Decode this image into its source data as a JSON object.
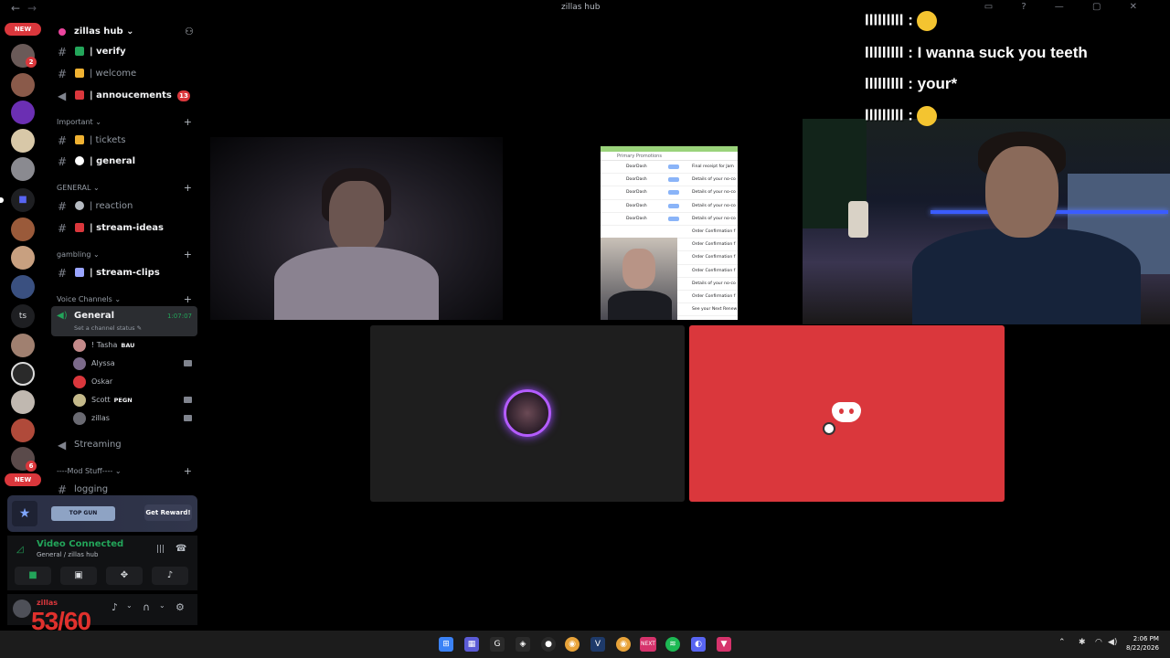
{
  "window": {
    "title": "zillas hub"
  },
  "guilds": {
    "new_label": "NEW",
    "mention_counts": [
      "2",
      "6"
    ],
    "text_guild": "ts"
  },
  "server": {
    "name": "zillas hub",
    "channels_top": [
      {
        "label": "| verify",
        "emoji_color": "#23a55a",
        "bright": true
      },
      {
        "label": "| welcome",
        "emoji_color": "#f0b232",
        "bright": false
      },
      {
        "label": "| annoucements",
        "emoji_color": "#da373c",
        "bright": true,
        "badge": "13"
      }
    ],
    "categories": {
      "important": "Important",
      "general": "GENERAL",
      "gambling": "gambling",
      "voice": "Voice Channels",
      "mod": "----Mod Stuff----"
    },
    "important_channels": [
      {
        "label": "| tickets",
        "emoji_color": "#f0b232",
        "bright": false
      },
      {
        "label": "| general",
        "emoji_color": "#ffffff",
        "bright": true
      }
    ],
    "general_channels": [
      {
        "label": "| reaction",
        "emoji_color": "#b5bac1",
        "bright": false
      },
      {
        "label": "| stream-ideas",
        "emoji_color": "#da373c",
        "bright": true
      }
    ],
    "gambling_channels": [
      {
        "label": "| stream-clips",
        "emoji_color": "#9aa5ff",
        "bright": true
      }
    ],
    "voice_channel": {
      "name": "General",
      "time": "1:07:07",
      "status": "Set a channel status"
    },
    "voice_users": [
      {
        "name": "! Tasha",
        "tag": "BAU",
        "av": "#c48a8a"
      },
      {
        "name": "Alyssa",
        "tag": "",
        "av": "#7b6a8a"
      },
      {
        "name": "Oskar",
        "tag": "",
        "av": "#da373c"
      },
      {
        "name": "Scott",
        "tag": "PEGN",
        "av": "#c4b98a"
      },
      {
        "name": "zillas",
        "tag": "",
        "av": "#6a6a72"
      }
    ],
    "streaming_channel": "Streaming",
    "mod_channel": "logging"
  },
  "promo": {
    "brand": "TOP GUN",
    "cta": "Get Reward!"
  },
  "voice_connected": {
    "status": "Video Connected",
    "location": "General / zillas hub"
  },
  "user": {
    "name": "zillas"
  },
  "overlay": {
    "fps": "53/60"
  },
  "chat": [
    {
      "user": "lllllllll",
      "text": ":",
      "emoji": true
    },
    {
      "user": "lllllllll",
      "text": ": I wanna suck you teeth",
      "emoji": false
    },
    {
      "user": "lllllllll",
      "text": ": your*",
      "emoji": false
    },
    {
      "user": "lllllllll",
      "text": ":",
      "emoji": true
    }
  ],
  "inbox": {
    "tabs": "Primary        Promotions",
    "rows": [
      {
        "sender": "DoorDash",
        "subject": "Final receipt for Jam"
      },
      {
        "sender": "DoorDash",
        "subject": "Details of your no-co"
      },
      {
        "sender": "DoorDash",
        "subject": "Details of your no-co"
      },
      {
        "sender": "DoorDash",
        "subject": "Details of your no-co"
      },
      {
        "sender": "DoorDash",
        "subject": "Details of your no-co"
      },
      {
        "sender": "",
        "subject": "Order Confirmation f"
      },
      {
        "sender": "",
        "subject": "Order Confirmation f"
      },
      {
        "sender": "",
        "subject": "Order Confirmation f"
      },
      {
        "sender": "",
        "subject": "Order Confirmation f"
      },
      {
        "sender": "",
        "subject": "Details of your no-co"
      },
      {
        "sender": "",
        "subject": "Order Confirmation f"
      },
      {
        "sender": "",
        "subject": "See your Next Renew"
      }
    ]
  },
  "taskbar": {
    "time": "2:06 PM",
    "date": "8/22/2026"
  }
}
